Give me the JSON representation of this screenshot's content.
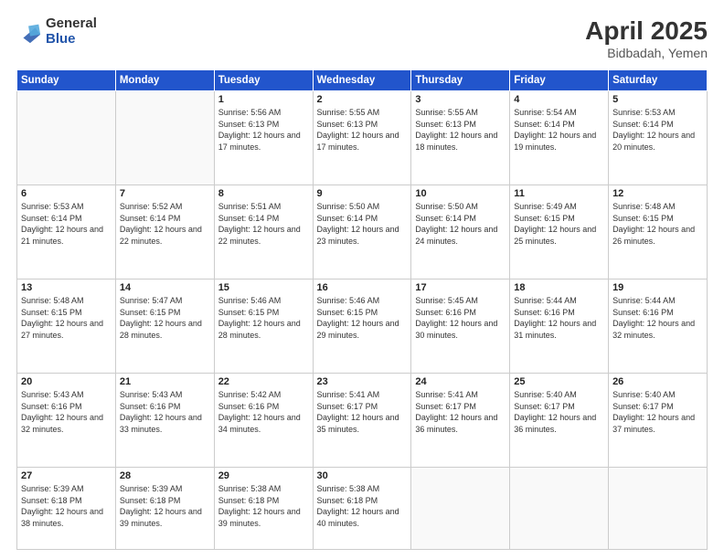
{
  "logo": {
    "general": "General",
    "blue": "Blue"
  },
  "header": {
    "title": "April 2025",
    "location": "Bidbadah, Yemen"
  },
  "weekdays": [
    "Sunday",
    "Monday",
    "Tuesday",
    "Wednesday",
    "Thursday",
    "Friday",
    "Saturday"
  ],
  "weeks": [
    [
      {
        "num": "",
        "info": ""
      },
      {
        "num": "",
        "info": ""
      },
      {
        "num": "1",
        "info": "Sunrise: 5:56 AM\nSunset: 6:13 PM\nDaylight: 12 hours and 17 minutes."
      },
      {
        "num": "2",
        "info": "Sunrise: 5:55 AM\nSunset: 6:13 PM\nDaylight: 12 hours and 17 minutes."
      },
      {
        "num": "3",
        "info": "Sunrise: 5:55 AM\nSunset: 6:13 PM\nDaylight: 12 hours and 18 minutes."
      },
      {
        "num": "4",
        "info": "Sunrise: 5:54 AM\nSunset: 6:14 PM\nDaylight: 12 hours and 19 minutes."
      },
      {
        "num": "5",
        "info": "Sunrise: 5:53 AM\nSunset: 6:14 PM\nDaylight: 12 hours and 20 minutes."
      }
    ],
    [
      {
        "num": "6",
        "info": "Sunrise: 5:53 AM\nSunset: 6:14 PM\nDaylight: 12 hours and 21 minutes."
      },
      {
        "num": "7",
        "info": "Sunrise: 5:52 AM\nSunset: 6:14 PM\nDaylight: 12 hours and 22 minutes."
      },
      {
        "num": "8",
        "info": "Sunrise: 5:51 AM\nSunset: 6:14 PM\nDaylight: 12 hours and 22 minutes."
      },
      {
        "num": "9",
        "info": "Sunrise: 5:50 AM\nSunset: 6:14 PM\nDaylight: 12 hours and 23 minutes."
      },
      {
        "num": "10",
        "info": "Sunrise: 5:50 AM\nSunset: 6:14 PM\nDaylight: 12 hours and 24 minutes."
      },
      {
        "num": "11",
        "info": "Sunrise: 5:49 AM\nSunset: 6:15 PM\nDaylight: 12 hours and 25 minutes."
      },
      {
        "num": "12",
        "info": "Sunrise: 5:48 AM\nSunset: 6:15 PM\nDaylight: 12 hours and 26 minutes."
      }
    ],
    [
      {
        "num": "13",
        "info": "Sunrise: 5:48 AM\nSunset: 6:15 PM\nDaylight: 12 hours and 27 minutes."
      },
      {
        "num": "14",
        "info": "Sunrise: 5:47 AM\nSunset: 6:15 PM\nDaylight: 12 hours and 28 minutes."
      },
      {
        "num": "15",
        "info": "Sunrise: 5:46 AM\nSunset: 6:15 PM\nDaylight: 12 hours and 28 minutes."
      },
      {
        "num": "16",
        "info": "Sunrise: 5:46 AM\nSunset: 6:15 PM\nDaylight: 12 hours and 29 minutes."
      },
      {
        "num": "17",
        "info": "Sunrise: 5:45 AM\nSunset: 6:16 PM\nDaylight: 12 hours and 30 minutes."
      },
      {
        "num": "18",
        "info": "Sunrise: 5:44 AM\nSunset: 6:16 PM\nDaylight: 12 hours and 31 minutes."
      },
      {
        "num": "19",
        "info": "Sunrise: 5:44 AM\nSunset: 6:16 PM\nDaylight: 12 hours and 32 minutes."
      }
    ],
    [
      {
        "num": "20",
        "info": "Sunrise: 5:43 AM\nSunset: 6:16 PM\nDaylight: 12 hours and 32 minutes."
      },
      {
        "num": "21",
        "info": "Sunrise: 5:43 AM\nSunset: 6:16 PM\nDaylight: 12 hours and 33 minutes."
      },
      {
        "num": "22",
        "info": "Sunrise: 5:42 AM\nSunset: 6:16 PM\nDaylight: 12 hours and 34 minutes."
      },
      {
        "num": "23",
        "info": "Sunrise: 5:41 AM\nSunset: 6:17 PM\nDaylight: 12 hours and 35 minutes."
      },
      {
        "num": "24",
        "info": "Sunrise: 5:41 AM\nSunset: 6:17 PM\nDaylight: 12 hours and 36 minutes."
      },
      {
        "num": "25",
        "info": "Sunrise: 5:40 AM\nSunset: 6:17 PM\nDaylight: 12 hours and 36 minutes."
      },
      {
        "num": "26",
        "info": "Sunrise: 5:40 AM\nSunset: 6:17 PM\nDaylight: 12 hours and 37 minutes."
      }
    ],
    [
      {
        "num": "27",
        "info": "Sunrise: 5:39 AM\nSunset: 6:18 PM\nDaylight: 12 hours and 38 minutes."
      },
      {
        "num": "28",
        "info": "Sunrise: 5:39 AM\nSunset: 6:18 PM\nDaylight: 12 hours and 39 minutes."
      },
      {
        "num": "29",
        "info": "Sunrise: 5:38 AM\nSunset: 6:18 PM\nDaylight: 12 hours and 39 minutes."
      },
      {
        "num": "30",
        "info": "Sunrise: 5:38 AM\nSunset: 6:18 PM\nDaylight: 12 hours and 40 minutes."
      },
      {
        "num": "",
        "info": ""
      },
      {
        "num": "",
        "info": ""
      },
      {
        "num": "",
        "info": ""
      }
    ]
  ]
}
